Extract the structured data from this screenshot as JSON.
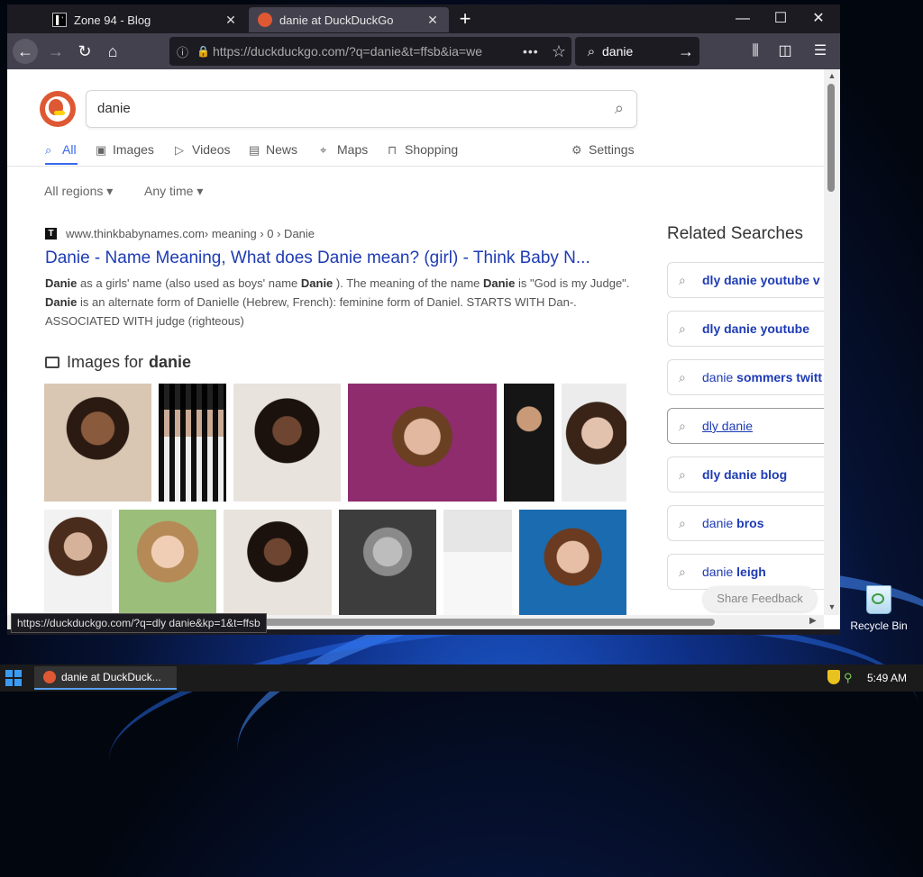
{
  "browser": {
    "tabs": [
      {
        "title": "Zone 94 - Blog",
        "active": false
      },
      {
        "title": "danie at DuckDuckGo",
        "active": true
      }
    ],
    "url_host": "https://duckduckgo.com",
    "url_path": "/?q=danie&t=ffsb&ia=we",
    "search_query": "danie",
    "status_url": "https://duckduckgo.com/?q=dly danie&kp=1&t=ffsb"
  },
  "page": {
    "search_value": "danie",
    "tabs": [
      "All",
      "Images",
      "Videos",
      "News",
      "Maps",
      "Shopping"
    ],
    "settings": "Settings",
    "filters": {
      "region": "All regions ▾",
      "time": "Any time ▾"
    },
    "result": {
      "site": "www.thinkbabynames.com",
      "path": " › meaning › 0 › Danie",
      "title": "Danie - Name Meaning, What does Danie mean? (girl) - Think Baby N..."
    },
    "images_heading": "Images for",
    "images_query": "danie",
    "related_title": "Related Searches",
    "related": [
      {
        "plain": "",
        "bold": "dly danie youtube v"
      },
      {
        "plain": "",
        "bold": "dly danie youtube"
      },
      {
        "plain": "danie",
        "bold": " sommers twitt"
      },
      {
        "plain": "dly danie",
        "bold": ""
      },
      {
        "plain": "",
        "bold": "dly danie blog"
      },
      {
        "plain": "danie",
        "bold": " bros"
      },
      {
        "plain": "danie",
        "bold": " leigh"
      }
    ],
    "feedback": "Share Feedback"
  },
  "desktop": {
    "recycle_bin": "Recycle Bin"
  },
  "taskbar": {
    "item": "danie at DuckDuck...",
    "time": "5:49 AM"
  },
  "colors": {
    "accent": "#3969ef",
    "link": "#1e3bb4",
    "ddg_orange": "#de5833"
  }
}
